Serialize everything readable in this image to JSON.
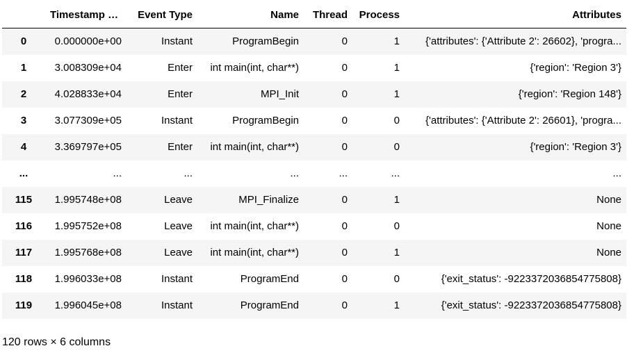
{
  "table": {
    "index_header": "",
    "columns": [
      "Timestamp (ns)",
      "Event Type",
      "Name",
      "Thread",
      "Process",
      "Attributes"
    ],
    "rows": [
      {
        "index": "0",
        "cells": [
          "0.000000e+00",
          "Instant",
          "ProgramBegin",
          "0",
          "1",
          "{'attributes': {'Attribute 2': 26602}, 'progra..."
        ]
      },
      {
        "index": "1",
        "cells": [
          "3.008309e+04",
          "Enter",
          "int main(int, char**)",
          "0",
          "1",
          "{'region': 'Region 3'}"
        ]
      },
      {
        "index": "2",
        "cells": [
          "4.028833e+04",
          "Enter",
          "MPI_Init",
          "0",
          "1",
          "{'region': 'Region 148'}"
        ]
      },
      {
        "index": "3",
        "cells": [
          "3.077309e+05",
          "Instant",
          "ProgramBegin",
          "0",
          "0",
          "{'attributes': {'Attribute 2': 26601}, 'progra..."
        ]
      },
      {
        "index": "4",
        "cells": [
          "3.369797e+05",
          "Enter",
          "int main(int, char**)",
          "0",
          "0",
          "{'region': 'Region 3'}"
        ]
      },
      {
        "index": "...",
        "cells": [
          "...",
          "...",
          "...",
          "...",
          "...",
          "..."
        ]
      },
      {
        "index": "115",
        "cells": [
          "1.995748e+08",
          "Leave",
          "MPI_Finalize",
          "0",
          "1",
          "None"
        ]
      },
      {
        "index": "116",
        "cells": [
          "1.995752e+08",
          "Leave",
          "int main(int, char**)",
          "0",
          "0",
          "None"
        ]
      },
      {
        "index": "117",
        "cells": [
          "1.995768e+08",
          "Leave",
          "int main(int, char**)",
          "0",
          "1",
          "None"
        ]
      },
      {
        "index": "118",
        "cells": [
          "1.996033e+08",
          "Instant",
          "ProgramEnd",
          "0",
          "0",
          "{'exit_status': -9223372036854775808}"
        ]
      },
      {
        "index": "119",
        "cells": [
          "1.996045e+08",
          "Instant",
          "ProgramEnd",
          "0",
          "1",
          "{'exit_status': -9223372036854775808}"
        ]
      }
    ]
  },
  "shape_text": "120 rows × 6 columns"
}
